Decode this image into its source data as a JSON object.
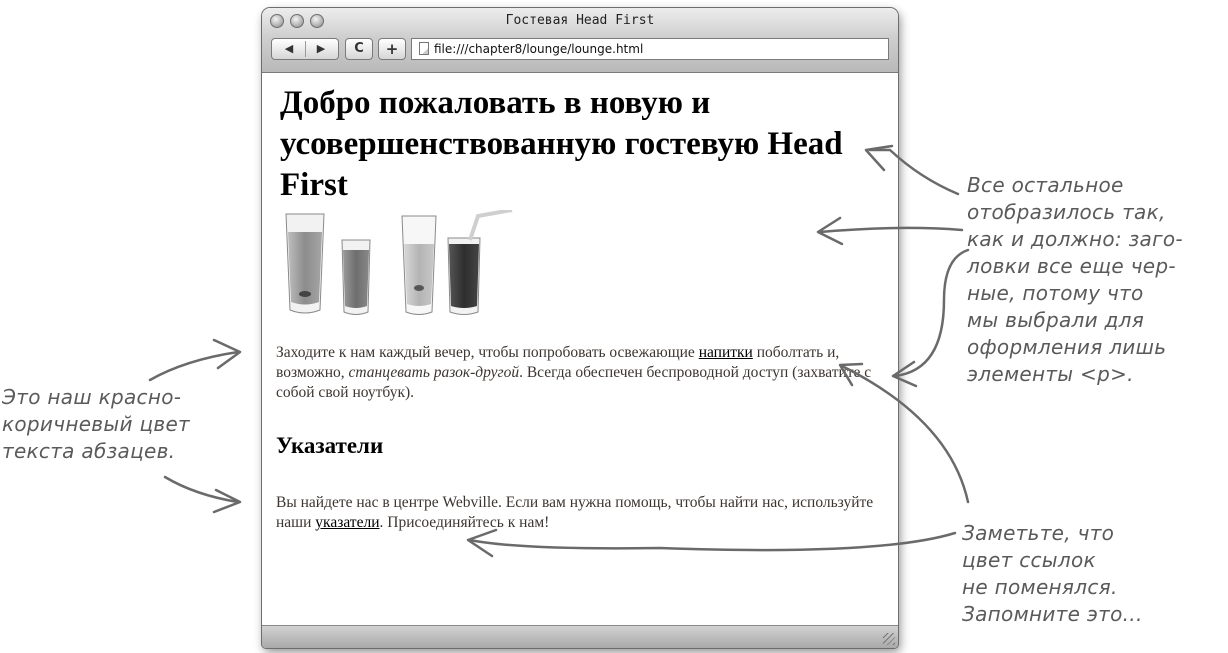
{
  "browser": {
    "window_title": "Гостевая Head First",
    "address": "file:///chapter8/lounge/lounge.html",
    "back_glyph": "◀",
    "forward_glyph": "▶",
    "reload_glyph": "C",
    "add_glyph": "+"
  },
  "page": {
    "heading": "Добро пожаловать в новую и усовершенствованную гостевую Head First",
    "para1": {
      "before_link": "Заходите к нам каждый вечер, чтобы попробовать освежающие ",
      "link": "напитки",
      "middle": " поболтать и, возможно, ",
      "emphasis": "станцевать разок-другой",
      "after": ". Всегда обеспечен беспроводной доступ (захватите с собой свой ноутбук)."
    },
    "subheading": "Указатели",
    "para2": {
      "before_link": "Вы найдете нас в центре Webville. Если вам нужна помощь, чтобы найти нас, используйте наши ",
      "link": "указатели",
      "after": ". Присоединяйтесь к нам!"
    }
  },
  "annotations": {
    "left": "Это наш красно-\nкоричневый цвет\nтекста абзацев.",
    "right": "Все остальное\nотобразилось так,\nкак и должно: заго-\nловки все еще чер-\nные, потому что\nмы выбрали для\nоформления лишь\nэлементы <p>.",
    "bottom": "Заметьте, что\nцвет ссылок\nне поменялся.\nЗапомните это..."
  },
  "colors": {
    "paragraph_text": "#3d3530",
    "annotation": "#5a5a5a"
  },
  "icons": [
    "back-arrow-icon",
    "forward-arrow-icon",
    "reload-icon",
    "add-bookmark-icon",
    "page-document-icon",
    "resize-grip-icon"
  ]
}
